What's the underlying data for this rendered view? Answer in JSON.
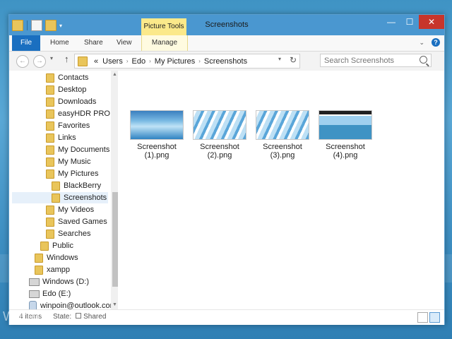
{
  "window": {
    "title": "Screenshots",
    "context_tab": "Picture Tools",
    "controls": {
      "minimize": "—",
      "maximize": "☐",
      "close": "✕"
    }
  },
  "ribbon": {
    "tabs": [
      "File",
      "Home",
      "Share",
      "View",
      "Manage"
    ]
  },
  "navigation": {
    "breadcrumb_prefix": "«",
    "breadcrumb": [
      "Users",
      "Edo",
      "My Pictures",
      "Screenshots"
    ],
    "search_placeholder": "Search Screenshots"
  },
  "sidebar": {
    "items": [
      {
        "label": "Contacts",
        "icon": "contacts-folder"
      },
      {
        "label": "Desktop",
        "icon": "desktop-folder"
      },
      {
        "label": "Downloads",
        "icon": "downloads-folder"
      },
      {
        "label": "easyHDR PRO 2",
        "icon": "folder"
      },
      {
        "label": "Favorites",
        "icon": "favorites-folder"
      },
      {
        "label": "Links",
        "icon": "links-folder"
      },
      {
        "label": "My Documents",
        "icon": "documents-folder"
      },
      {
        "label": "My Music",
        "icon": "music-folder"
      },
      {
        "label": "My Pictures",
        "icon": "pictures-folder"
      },
      {
        "label": "BlackBerry",
        "icon": "folder"
      },
      {
        "label": "Screenshots",
        "icon": "folder",
        "selected": true
      },
      {
        "label": "My Videos",
        "icon": "videos-folder"
      },
      {
        "label": "Saved Games",
        "icon": "saved-games-folder"
      },
      {
        "label": "Searches",
        "icon": "searches-folder"
      },
      {
        "label": "Public",
        "icon": "folder"
      },
      {
        "label": "Windows",
        "icon": "folder"
      },
      {
        "label": "xampp",
        "icon": "folder"
      },
      {
        "label": "Windows (D:)",
        "icon": "drive"
      },
      {
        "label": "Edo (E:)",
        "icon": "drive"
      },
      {
        "label": "winpoin@outlook.con",
        "icon": "user"
      }
    ]
  },
  "files": [
    {
      "name_line1": "Screenshot",
      "name_line2": "(1).png"
    },
    {
      "name_line1": "Screenshot",
      "name_line2": "(2).png"
    },
    {
      "name_line1": "Screenshot",
      "name_line2": "(3).png"
    },
    {
      "name_line1": "Screenshot",
      "name_line2": "(4).png"
    }
  ],
  "status": {
    "items_count": "4 items",
    "state_label": "State:",
    "state_value": "Shared"
  },
  "watermark": "WinPoin",
  "colors": {
    "titlebar": "#4a97d0",
    "file_tab": "#1a6fc0",
    "context_tab": "#fbe98a",
    "close_button": "#c7352b"
  }
}
